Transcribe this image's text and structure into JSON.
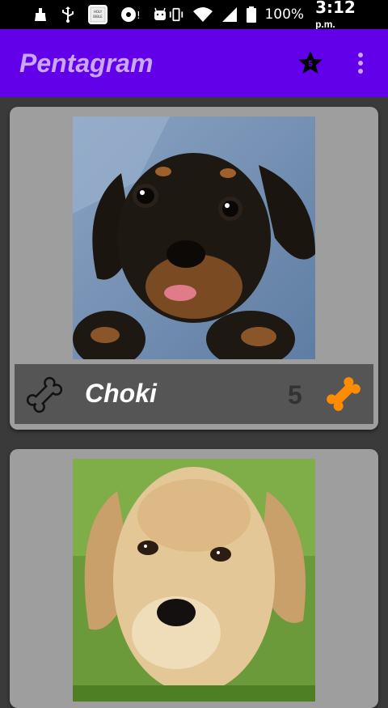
{
  "status_bar": {
    "battery_percent": "100%",
    "time": "3:12",
    "ampm": "p.m.",
    "bible_icon_text": "HOLY BIBLE"
  },
  "app_bar": {
    "title": "Pentagram",
    "star_badge": "5"
  },
  "cards": [
    {
      "name": "Choki",
      "count": "5",
      "photo": "black-tan-dachshund-puppy"
    },
    {
      "photo": "yellow-labrador-puppy"
    }
  ],
  "colors": {
    "app_bar": "#6200ea",
    "title": "#c9a6ff",
    "bone_active": "#ff8c00",
    "card": "#9e9e9e",
    "info_bar": "#555555"
  }
}
